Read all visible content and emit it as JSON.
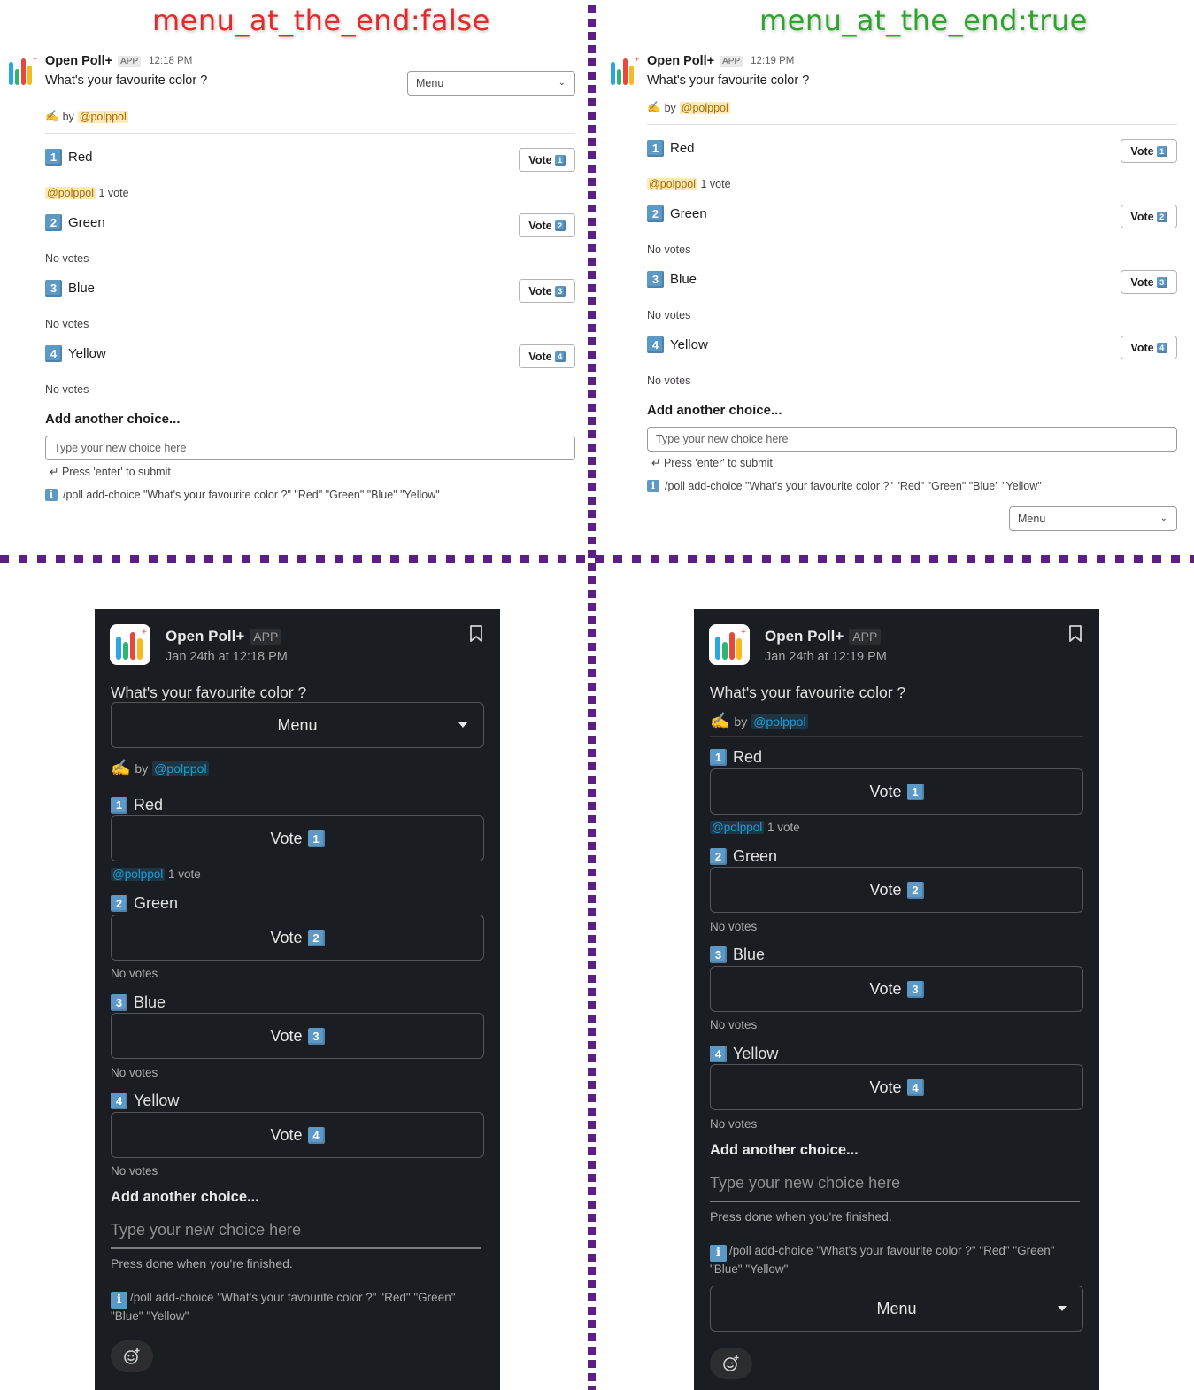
{
  "headings": {
    "left": "menu_at_the_end:false",
    "right": "menu_at_the_end:true"
  },
  "colors": {
    "false_heading": "#e32b2b",
    "true_heading": "#2ea42e",
    "divider": "#5c1f86",
    "dark_bg": "#1a1d21",
    "mention_dark": "#1d9bd1"
  },
  "light_left": {
    "app_name": "Open Poll+",
    "app_badge": "APP",
    "time": "12:18 PM",
    "question": "What's your favourite color ?",
    "menu_label": "Menu",
    "by_text": "by",
    "author": "@polppol",
    "choices": [
      {
        "num": "1",
        "label": "Red",
        "vote_label": "Vote",
        "voter": "@polppol",
        "votes": "1 vote"
      },
      {
        "num": "2",
        "label": "Green",
        "vote_label": "Vote",
        "votes": "No votes"
      },
      {
        "num": "3",
        "label": "Blue",
        "vote_label": "Vote",
        "votes": "No votes"
      },
      {
        "num": "4",
        "label": "Yellow",
        "vote_label": "Vote",
        "votes": "No votes"
      }
    ],
    "add_title": "Add another choice...",
    "input_placeholder": "Type your new choice here",
    "hint": "↵ Press 'enter' to submit",
    "command": "/poll add-choice \"What's your favourite color ?\" \"Red\" \"Green\" \"Blue\" \"Yellow\""
  },
  "light_right": {
    "app_name": "Open Poll+",
    "app_badge": "APP",
    "time": "12:19 PM",
    "question": "What's your favourite color ?",
    "menu_label": "Menu",
    "by_text": "by",
    "author": "@polppol",
    "choices": [
      {
        "num": "1",
        "label": "Red",
        "vote_label": "Vote",
        "voter": "@polppol",
        "votes": "1 vote"
      },
      {
        "num": "2",
        "label": "Green",
        "vote_label": "Vote",
        "votes": "No votes"
      },
      {
        "num": "3",
        "label": "Blue",
        "vote_label": "Vote",
        "votes": "No votes"
      },
      {
        "num": "4",
        "label": "Yellow",
        "vote_label": "Vote",
        "votes": "No votes"
      }
    ],
    "add_title": "Add another choice...",
    "input_placeholder": "Type your new choice here",
    "hint": "↵ Press 'enter' to submit",
    "command": "/poll add-choice \"What's your favourite color ?\" \"Red\" \"Green\" \"Blue\" \"Yellow\""
  },
  "dark_left": {
    "app_name": "Open Poll+",
    "app_badge": "APP",
    "time": "Jan 24th at 12:18 PM",
    "question": "What's your favourite color ?",
    "menu_label": "Menu",
    "by_text": "by",
    "author": "@polppol",
    "choices": [
      {
        "num": "1",
        "label": "Red",
        "vote_label": "Vote",
        "voter": "@polppol",
        "votes": "1 vote"
      },
      {
        "num": "2",
        "label": "Green",
        "vote_label": "Vote",
        "votes": "No votes"
      },
      {
        "num": "3",
        "label": "Blue",
        "vote_label": "Vote",
        "votes": "No votes"
      },
      {
        "num": "4",
        "label": "Yellow",
        "vote_label": "Vote",
        "votes": "No votes"
      }
    ],
    "add_title": "Add another choice...",
    "input_placeholder": "Type your new choice here",
    "press_done": "Press done when you're finished.",
    "command": "/poll add-choice \"What's your favourite color ?\" \"Red\" \"Green\" \"Blue\" \"Yellow\""
  },
  "dark_right": {
    "app_name": "Open Poll+",
    "app_badge": "APP",
    "time": "Jan 24th at 12:19 PM",
    "question": "What's your favourite color ?",
    "menu_label": "Menu",
    "by_text": "by",
    "author": "@polppol",
    "choices": [
      {
        "num": "1",
        "label": "Red",
        "vote_label": "Vote",
        "voter": "@polppol",
        "votes": "1 vote"
      },
      {
        "num": "2",
        "label": "Green",
        "vote_label": "Vote",
        "votes": "No votes"
      },
      {
        "num": "3",
        "label": "Blue",
        "vote_label": "Vote",
        "votes": "No votes"
      },
      {
        "num": "4",
        "label": "Yellow",
        "vote_label": "Vote",
        "votes": "No votes"
      }
    ],
    "add_title": "Add another choice...",
    "input_placeholder": "Type your new choice here",
    "press_done": "Press done when you're finished.",
    "command": "/poll add-choice \"What's your favourite color ?\" \"Red\" \"Green\" \"Blue\" \"Yellow\""
  }
}
